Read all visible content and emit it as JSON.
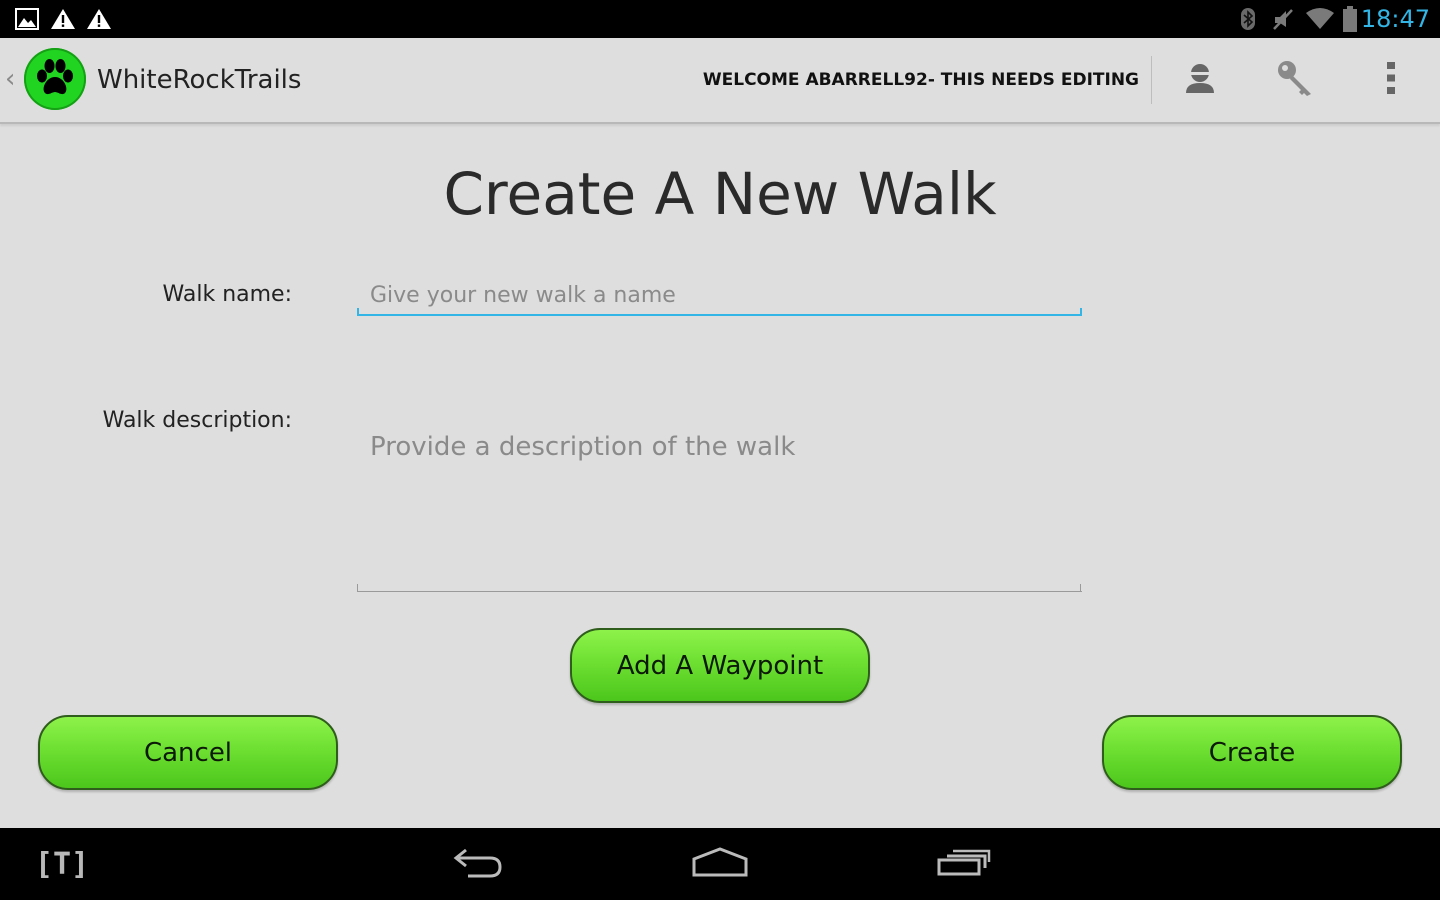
{
  "status_bar": {
    "time": "18:47",
    "left_icons": [
      "image-notification-icon",
      "warning-icon",
      "warning-icon"
    ],
    "right_icons": [
      "bluetooth-icon",
      "mute-icon",
      "wifi-icon",
      "battery-icon"
    ],
    "accent_color": "#33b5e5"
  },
  "action_bar": {
    "app_title": "WhiteRockTrails",
    "welcome_text": "WELCOME ABARRELL92- THIS NEEDS EDITING",
    "actions": [
      "profile-icon",
      "key-icon",
      "overflow-menu-icon"
    ]
  },
  "form": {
    "title": "Create A New Walk",
    "walk_name_label": "Walk name:",
    "walk_name_placeholder": "Give your new walk a name",
    "walk_name_value": "",
    "walk_description_label": "Walk description:",
    "walk_description_placeholder": "Provide a description of the walk",
    "walk_description_value": "",
    "add_waypoint_label": "Add A Waypoint",
    "cancel_label": "Cancel",
    "create_label": "Create",
    "button_color": "#6ee032"
  },
  "nav_bar": {
    "left_app_label": "[T]",
    "buttons": [
      "back-icon",
      "home-icon",
      "recent-apps-icon"
    ]
  }
}
